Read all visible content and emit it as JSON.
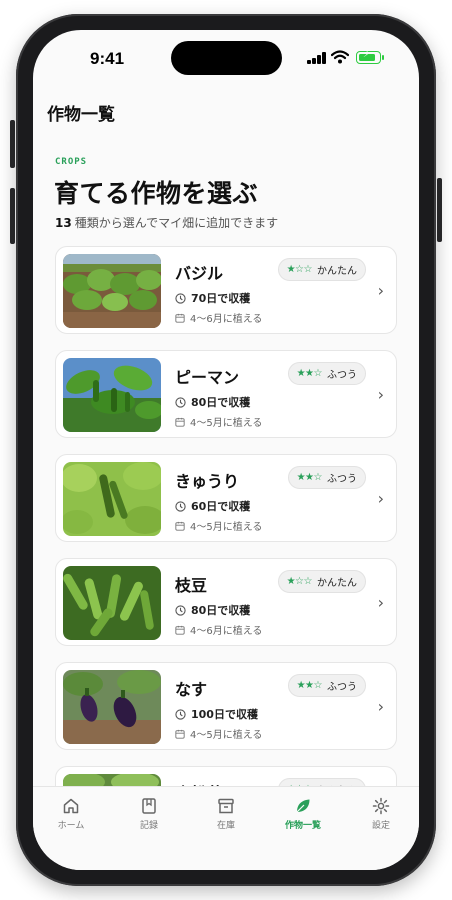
{
  "status": {
    "time": "9:41"
  },
  "nav": {
    "title": "作物一覧"
  },
  "header": {
    "eyebrow": "CROPS",
    "headline": "育てる作物を選ぶ",
    "count": "13",
    "subtitle": "種類から選んでマイ畑に追加できます"
  },
  "accent": "#2aa05a",
  "crops": [
    {
      "name": "バジル",
      "stars": "★☆☆",
      "difficulty": "かんたん",
      "harvest": "70日で収穫",
      "planting": "4〜6月に植える"
    },
    {
      "name": "ピーマン",
      "stars": "★★☆",
      "difficulty": "ふつう",
      "harvest": "80日で収穫",
      "planting": "4〜5月に植える"
    },
    {
      "name": "きゅうり",
      "stars": "★★☆",
      "difficulty": "ふつう",
      "harvest": "60日で収穫",
      "planting": "4〜5月に植える"
    },
    {
      "name": "枝豆",
      "stars": "★☆☆",
      "difficulty": "かんたん",
      "harvest": "80日で収穫",
      "planting": "4〜6月に植える"
    },
    {
      "name": "なす",
      "stars": "★★☆",
      "difficulty": "ふつう",
      "harvest": "100日で収穫",
      "planting": "4〜5月に植える"
    },
    {
      "name": "小松菜",
      "stars": "★☆☆",
      "difficulty": "かんたん",
      "harvest": "",
      "planting": ""
    }
  ],
  "tabs": [
    {
      "label": "ホーム",
      "icon": "home-icon"
    },
    {
      "label": "記録",
      "icon": "journal-icon"
    },
    {
      "label": "在庫",
      "icon": "archive-icon"
    },
    {
      "label": "作物一覧",
      "icon": "leaf-icon"
    },
    {
      "label": "設定",
      "icon": "gear-icon"
    }
  ]
}
